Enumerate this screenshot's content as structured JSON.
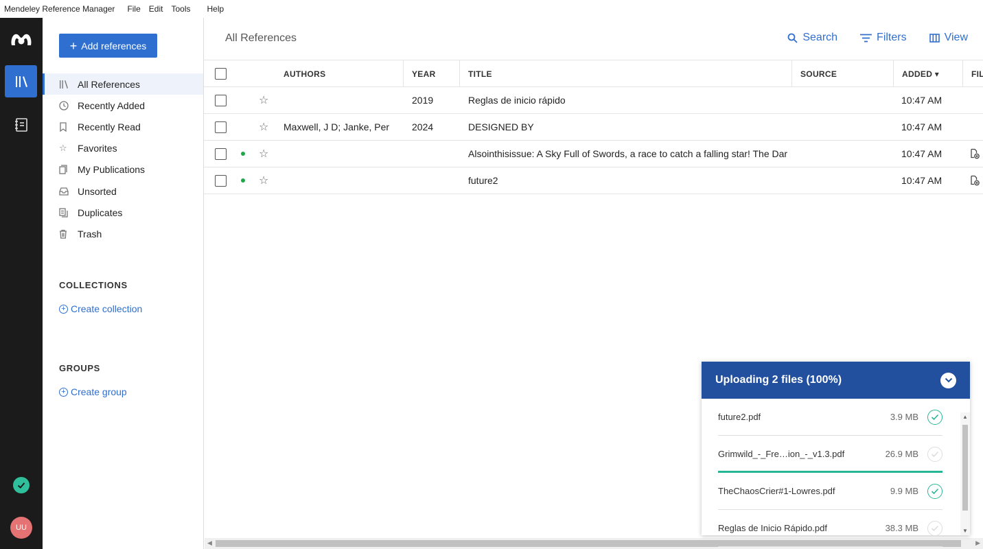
{
  "menubar": {
    "app_name": "Mendeley Reference Manager",
    "items": [
      "File",
      "Edit",
      "Tools",
      "Help"
    ]
  },
  "rail": {
    "avatar_initials": "UU",
    "icons": [
      "mendeley-logo-icon",
      "library-icon",
      "notebook-icon",
      "sync-status-icon"
    ]
  },
  "sidebar": {
    "add_label": "Add references",
    "nav": [
      {
        "label": "All References",
        "icon": "library-icon"
      },
      {
        "label": "Recently Added",
        "icon": "clock-icon"
      },
      {
        "label": "Recently Read",
        "icon": "bookmark-icon"
      },
      {
        "label": "Favorites",
        "icon": "star-icon"
      },
      {
        "label": "My Publications",
        "icon": "publication-icon"
      },
      {
        "label": "Unsorted",
        "icon": "inbox-icon"
      },
      {
        "label": "Duplicates",
        "icon": "duplicates-icon"
      },
      {
        "label": "Trash",
        "icon": "trash-icon"
      }
    ],
    "collections_heading": "COLLECTIONS",
    "create_collection": "Create collection",
    "groups_heading": "GROUPS",
    "create_group": "Create group"
  },
  "main": {
    "title": "All References",
    "toolbar": {
      "search": "Search",
      "filters": "Filters",
      "view": "View"
    },
    "columns": {
      "authors": "AUTHORS",
      "year": "YEAR",
      "title": "TITLE",
      "source": "SOURCE",
      "added": "ADDED ▾",
      "files": "FILE"
    },
    "rows": [
      {
        "authors": "",
        "year": "2019",
        "title": "Reglas de inicio rápido",
        "source": "",
        "added": "10:47 AM",
        "unread": false,
        "has_file": false
      },
      {
        "authors": "Maxwell, J D; Janke, Per",
        "year": "2024",
        "title": "DESIGNED BY",
        "source": "",
        "added": "10:47 AM",
        "unread": false,
        "has_file": false
      },
      {
        "authors": "",
        "year": "",
        "title": "Alsointhisissue: A Sky Full of Swords, a race to catch a falling star! The Dar…",
        "source": "",
        "added": "10:47 AM",
        "unread": true,
        "has_file": true
      },
      {
        "authors": "",
        "year": "",
        "title": "future2",
        "source": "",
        "added": "10:47 AM",
        "unread": true,
        "has_file": true
      }
    ]
  },
  "upload": {
    "title": "Uploading 2 files (100%)",
    "files": [
      {
        "name": "future2.pdf",
        "size": "3.9 MB",
        "done": true,
        "progress": null
      },
      {
        "name": "Grimwild_-_Fre…ion_-_v1.3.pdf",
        "size": "26.9 MB",
        "done": false,
        "progress": 1.0
      },
      {
        "name": "TheChaosCrier#1-Lowres.pdf",
        "size": "9.9 MB",
        "done": true,
        "progress": null
      },
      {
        "name": "Reglas de Inicio Rápido.pdf",
        "size": "38.3 MB",
        "done": false,
        "progress": null
      }
    ]
  },
  "colors": {
    "accent": "#2f6fcf",
    "upload_header": "#22509f",
    "success": "#25b795",
    "rail": "#1b1b1b",
    "unread_dot": "#1ea84a"
  }
}
